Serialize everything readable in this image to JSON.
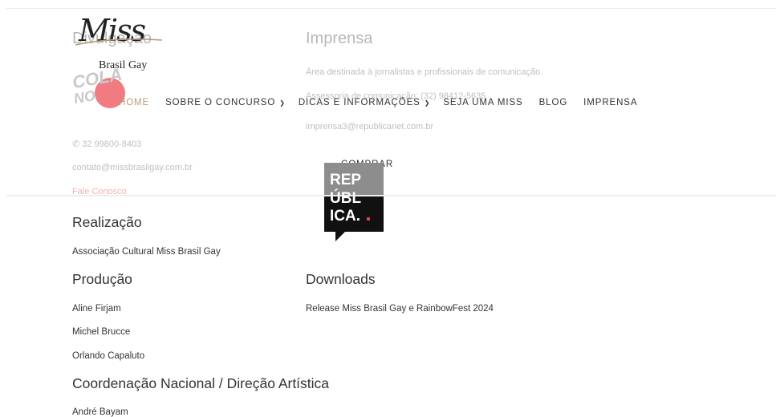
{
  "footer_faded": {
    "divulgacao_heading": "Divulgação",
    "phone": "32 99800-8403",
    "email": "contato@missbrasilgay.com.br",
    "contact_link": "Fale Conosco",
    "imprensa_heading": "Imprensa",
    "imprensa_desc": "Área destinada à jornalistas e profissionais de comunicação.",
    "imprensa_phone": "Assessoria de comunicação: (32) 98412-5635",
    "imprensa_email": "imprensa3@republicanet.com.br"
  },
  "logo": {
    "script": "Miss",
    "subtitle": "Brasil Gay"
  },
  "badge": {
    "line1": "COLA",
    "line2": "NO"
  },
  "nav": {
    "home": "HOME",
    "sobre": "SOBRE O CONCURSO",
    "dicas": "DICAS E INFORMAÇÕES",
    "seja": "SEJA UMA MISS",
    "blog": "BLOG",
    "imprensa": "IMPRENSA",
    "comprar": "COMPRAR",
    "caret": "⌄"
  },
  "republica_logo": {
    "line1": "REP",
    "line2": "ÚBL",
    "line3": "ICA."
  },
  "content": {
    "realizacao_heading": "Realização",
    "realizacao_text": "Associação Cultural Miss Brasil Gay",
    "producao_heading": "Produção",
    "producao_items": [
      "Aline Firjam",
      "Michel Brucce",
      "Orlando Capaluto"
    ],
    "downloads_heading": "Downloads",
    "downloads_item": "Release Miss Brasil Gay e RainbowFest 2024",
    "coordenacao_heading": "Coordenação Nacional / Direção Artística",
    "coordenacao_item": "André Bayam"
  }
}
